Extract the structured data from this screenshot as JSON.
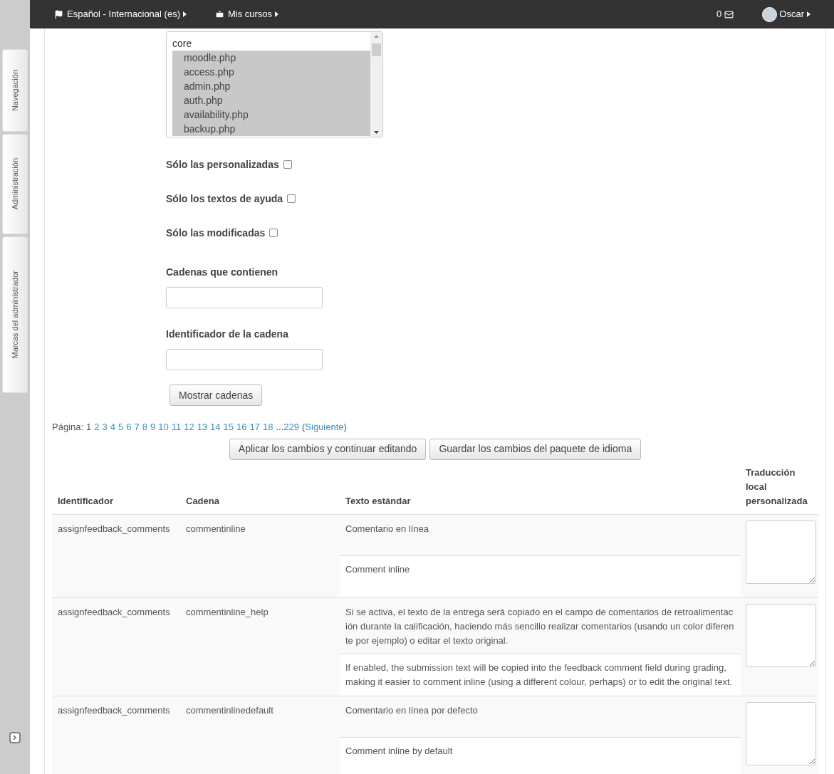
{
  "sidebar": {
    "tabs": [
      {
        "label": "Navegación"
      },
      {
        "label": "Administración"
      },
      {
        "label": "Marcas del administrador"
      }
    ]
  },
  "navbar": {
    "language": "Español - Internacional (es)",
    "courses": "Mis cursos",
    "messages": "0",
    "user": "Oscar"
  },
  "file_list": {
    "group": "core",
    "options": [
      {
        "label": "moodle.php",
        "selected": true
      },
      {
        "label": "access.php",
        "selected": true
      },
      {
        "label": "admin.php",
        "selected": true
      },
      {
        "label": "auth.php",
        "selected": true
      },
      {
        "label": "availability.php",
        "selected": true
      },
      {
        "label": "backup.php",
        "selected": true
      }
    ]
  },
  "filters": [
    {
      "label": "Sólo las personalizadas",
      "checked": false
    },
    {
      "label": "Sólo los textos de ayuda",
      "checked": false
    },
    {
      "label": "Sólo las modificadas",
      "checked": false
    }
  ],
  "fields": [
    {
      "label": "Cadenas que contienen"
    },
    {
      "label": "Identificador de la cadena"
    }
  ],
  "show_button": "Mostrar cadenas",
  "pagination": {
    "label": "Página:",
    "pages": [
      {
        "label": "1",
        "selected": true
      },
      {
        "label": "2",
        "selected": false
      },
      {
        "label": "3",
        "selected": false
      },
      {
        "label": "4",
        "selected": false
      },
      {
        "label": "5",
        "selected": false
      },
      {
        "label": "6",
        "selected": false
      },
      {
        "label": "7",
        "selected": false
      },
      {
        "label": "8",
        "selected": false
      },
      {
        "label": "9",
        "selected": false
      },
      {
        "label": "10",
        "selected": false
      },
      {
        "label": "11",
        "selected": false
      },
      {
        "label": "12",
        "selected": false
      },
      {
        "label": "13",
        "selected": false
      },
      {
        "label": "14",
        "selected": false
      },
      {
        "label": "15",
        "selected": false
      },
      {
        "label": "16",
        "selected": false
      },
      {
        "label": "17",
        "selected": false
      },
      {
        "label": "18",
        "selected": false
      }
    ],
    "ellipsis": "...",
    "last": "229",
    "next": "Siguiente",
    "open_paren": "(",
    "close_paren": ")"
  },
  "actions": [
    "Aplicar los cambios y continuar editando",
    "Guardar los cambios del paquete de idioma"
  ],
  "table": {
    "columns": [
      "Identificador",
      "Cadena",
      "Texto estándar",
      "Traducción local personalizada"
    ],
    "rows": [
      {
        "component": "assignfeedback_comments",
        "string": "commentinline",
        "local": "Comentario en línea",
        "english": "Comment inline"
      },
      {
        "component": "assignfeedback_comments",
        "string": "commentinline_help",
        "local": "Si se activa, el texto de la entrega será copiado en el campo de comentarios de retroalimentación durante la calificación, haciendo más sencillo realizar comentarios (usando un color diferente por ejemplo) o editar el texto original.",
        "english": "If enabled, the submission text will be copied into the feedback comment field during grading, making it easier to comment inline (using a different colour, perhaps) or to edit the original text."
      },
      {
        "component": "assignfeedback_comments",
        "string": "commentinlinedefault",
        "local": "Comentario en línea por defecto",
        "english": "Comment inline by default"
      }
    ]
  }
}
